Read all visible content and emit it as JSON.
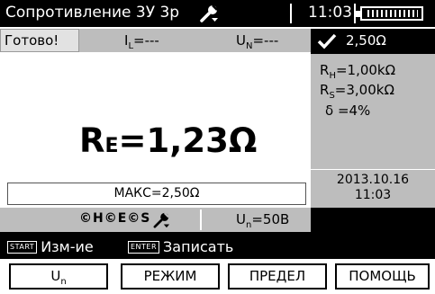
{
  "title": "Сопротивление 3У 3р",
  "clock": "11:03",
  "status": {
    "ready": "Готово!",
    "il": "I",
    "il_sub": "L",
    "il_value": "=---",
    "un": "U",
    "un_sub": "N",
    "un_value": "=---",
    "limit": "2,50Ω"
  },
  "params": {
    "rh": "R",
    "rh_sub": "H",
    "rh_value": "=1,00kΩ",
    "rs": "R",
    "rs_sub": "S",
    "rs_value": "=3,00kΩ",
    "delta": "δ =4%"
  },
  "result": {
    "r": "R",
    "r_sub": "E",
    "value": "=1,23Ω"
  },
  "max_line": "МАКС=2,50Ω",
  "date": "2013.10.16",
  "time": "11:03",
  "icon_text": "©H©E©S",
  "un_setting": {
    "u": "U",
    "sub": "n",
    "value": "=50В"
  },
  "hints": {
    "start_key": "START",
    "start_label": "Изм-ие",
    "enter_key": "ENTER",
    "enter_label": "Записать"
  },
  "buttons": {
    "f1": "U",
    "f1_sub": "n",
    "f2": "РЕЖИМ",
    "f3": "ПРЕДЕЛ",
    "f4": "ПОМОЩЬ"
  },
  "icons": {
    "title": "wrench-icon",
    "limit": "check-icon",
    "probe": "wrench-icon",
    "battery": "battery-icon"
  }
}
